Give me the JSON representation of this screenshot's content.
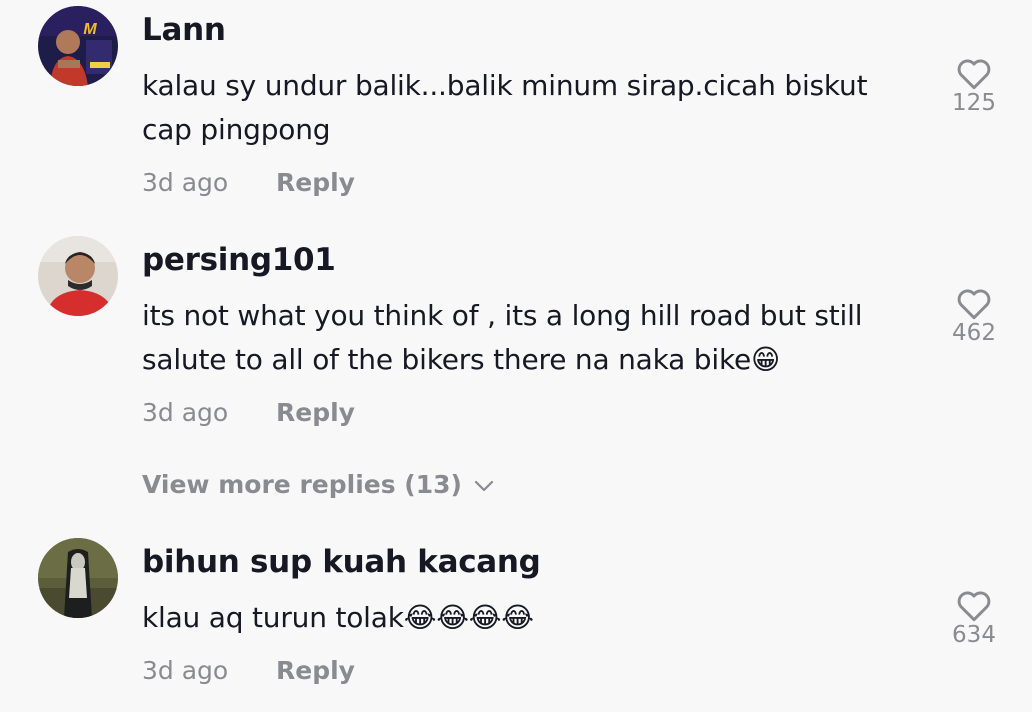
{
  "comments": [
    {
      "username": "Lann",
      "text": "kalau sy undur balik...balik minum sirap.cicah biskut cap pingpong",
      "age": "3d ago",
      "reply_label": "Reply",
      "likes": "125"
    },
    {
      "username": "persing101",
      "text": "its not what you think of , its a long hill road but still salute to all of the bikers there na naka bike",
      "emoji": "😁",
      "age": "3d ago",
      "reply_label": "Reply",
      "likes": "462"
    },
    {
      "username": "bihun sup kuah kacang",
      "text": "klau aq turun tolak",
      "emoji": "😂😂😂😂",
      "age": "3d ago",
      "reply_label": "Reply",
      "likes": "634"
    }
  ],
  "view_more": {
    "label": "View more replies (13)"
  },
  "icons": {
    "like": "heart-outline-icon",
    "expand": "chevron-down-icon"
  },
  "colors": {
    "background": "#f8f8f8",
    "primary_text": "#161823",
    "secondary_text": "#8a8b91"
  }
}
